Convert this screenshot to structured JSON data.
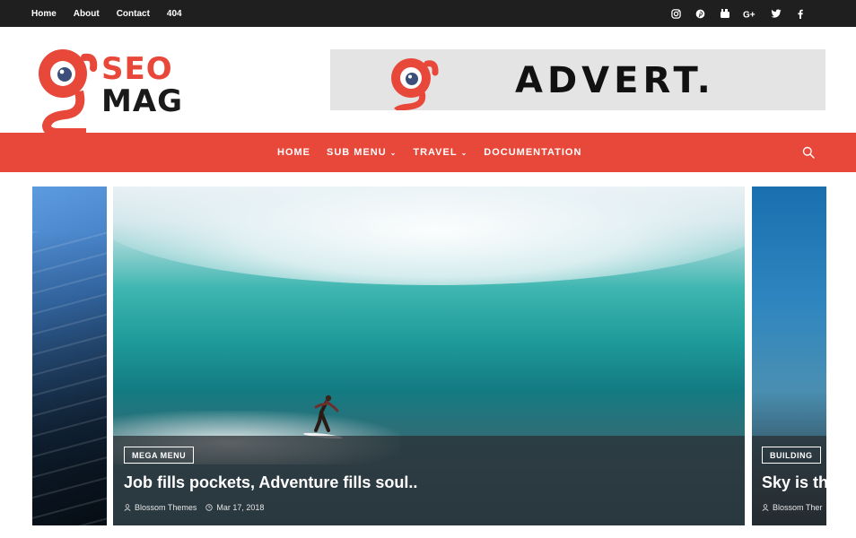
{
  "topbar": {
    "nav": [
      "Home",
      "About",
      "Contact",
      "404"
    ],
    "social_icons": [
      "instagram-icon",
      "pinterest-icon",
      "youtube-icon",
      "google-plus-icon",
      "twitter-icon",
      "facebook-icon"
    ]
  },
  "brand": {
    "logo_line1": "SEO",
    "logo_line2": "MAG",
    "accent_color": "#e8483a"
  },
  "advert": {
    "text": "ADVERT."
  },
  "menu": {
    "items": [
      {
        "label": "HOME"
      },
      {
        "label": "SUB MENU",
        "dropdown": true
      },
      {
        "label": "TRAVEL",
        "dropdown": true
      },
      {
        "label": "DOCUMENTATION"
      }
    ],
    "search_icon": "search-icon"
  },
  "slider": {
    "main": {
      "category": "MEGA MENU",
      "title": "Job fills pockets, Adventure fills soul..",
      "author": "Blossom Themes",
      "date": "Mar 17, 2018"
    },
    "next": {
      "category": "BUILDING",
      "title": "Sky is th",
      "author": "Blossom Ther"
    }
  }
}
